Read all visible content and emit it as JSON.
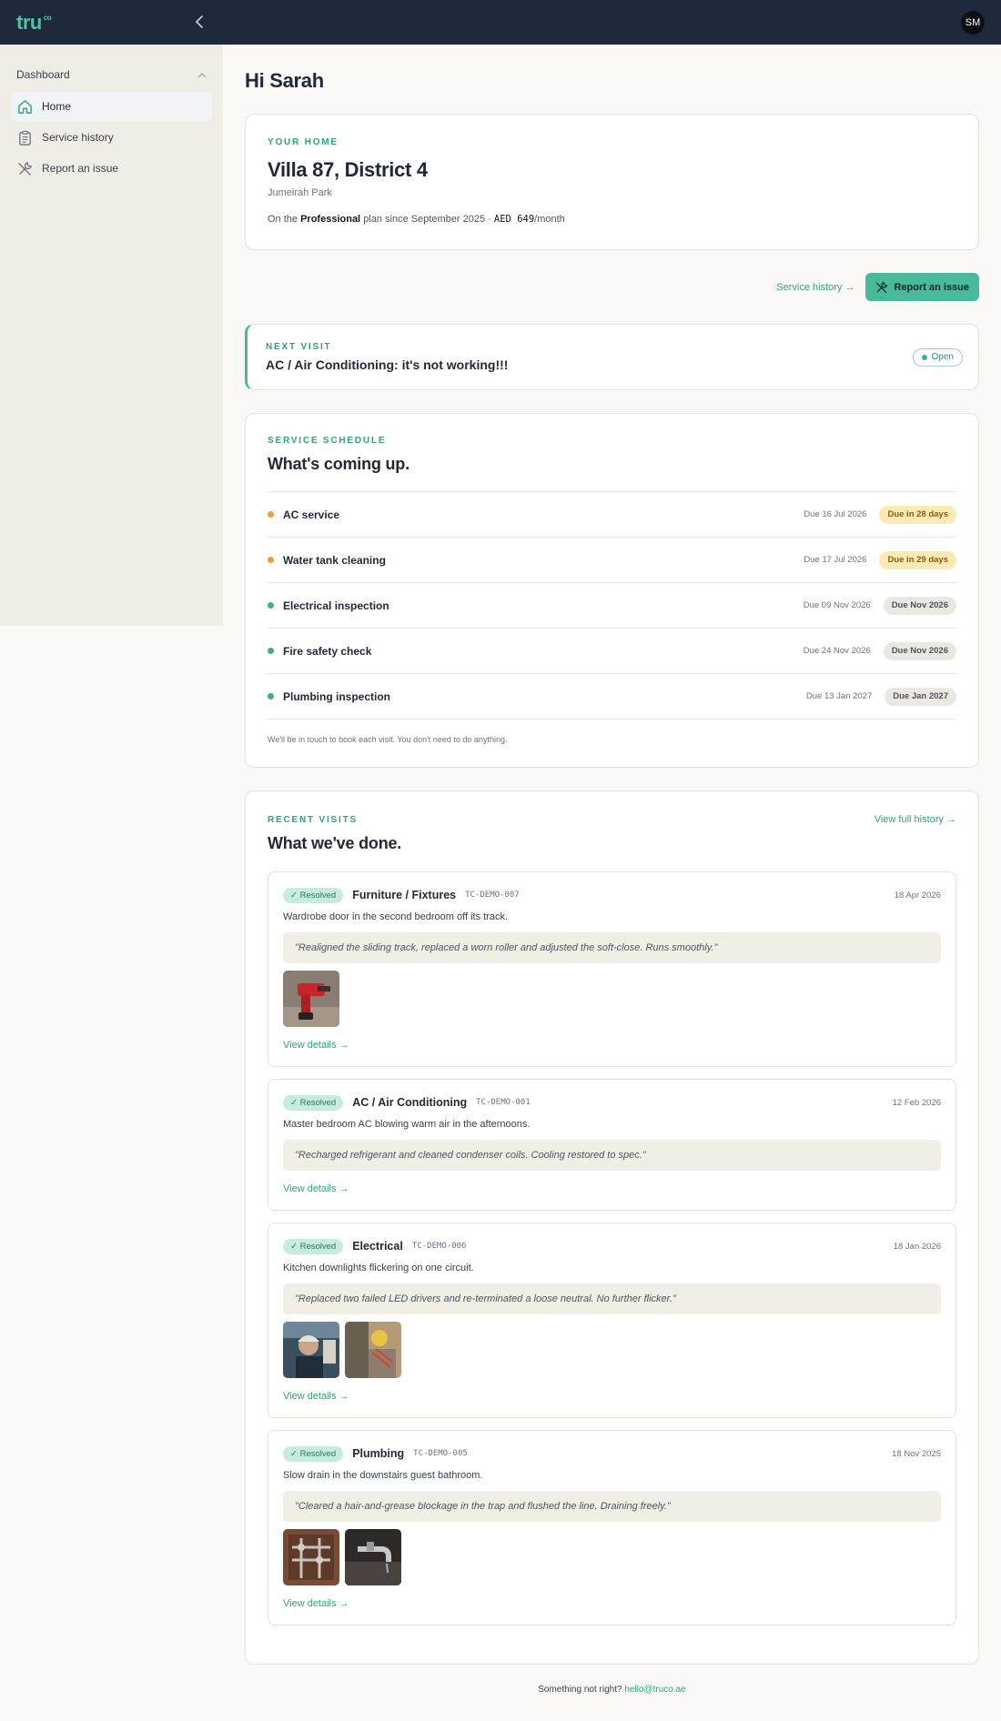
{
  "topbar": {
    "logo_text": "tru",
    "logo_sup": "co",
    "avatar_initials": "SM"
  },
  "sidebar": {
    "group_label": "Dashboard",
    "items": [
      {
        "label": "Home",
        "icon": "home-icon",
        "active": true
      },
      {
        "label": "Service history",
        "icon": "clipboard-icon",
        "active": false
      },
      {
        "label": "Report an issue",
        "icon": "tools-icon",
        "active": false
      }
    ]
  },
  "greeting": "Hi Sarah",
  "home": {
    "eyebrow": "YOUR HOME",
    "title": "Villa 87, District 4",
    "subtitle": "Jumeirah Park",
    "plan_prefix": "On the",
    "plan_name": "Professional",
    "plan_since": "plan since September 2025 ·",
    "plan_price": "AED 649",
    "plan_suffix": "/month"
  },
  "actions": {
    "history_link": "Service history →",
    "report_button": "Report an issue"
  },
  "next_visit": {
    "eyebrow": "NEXT VISIT",
    "title": "AC / Air Conditioning: it's not working!!!",
    "status": "Open"
  },
  "schedule": {
    "eyebrow": "SERVICE SCHEDULE",
    "title": "What's coming up.",
    "rows": [
      {
        "name": "AC service",
        "due": "Due 16 Jul 2026",
        "badge": "Due in 28 days",
        "kind": "warn",
        "dot": "#e8a23a"
      },
      {
        "name": "Water tank cleaning",
        "due": "Due 17 Jul 2026",
        "badge": "Due in 29 days",
        "kind": "warn",
        "dot": "#e8a23a"
      },
      {
        "name": "Electrical inspection",
        "due": "Due 09 Nov 2026",
        "badge": "Due Nov 2026",
        "kind": "neutral",
        "dot": "#3eaf8c"
      },
      {
        "name": "Fire safety check",
        "due": "Due 24 Nov 2026",
        "badge": "Due Nov 2026",
        "kind": "neutral",
        "dot": "#3eaf8c"
      },
      {
        "name": "Plumbing inspection",
        "due": "Due 13 Jan 2027",
        "badge": "Due Jan 2027",
        "kind": "neutral",
        "dot": "#3eaf8c"
      }
    ],
    "note": "We'll be in touch to book each visit. You don't need to do anything."
  },
  "recent": {
    "eyebrow": "RECENT VISITS",
    "title": "What we've done.",
    "full_history": "View full history →",
    "visits": [
      {
        "status": "✓ Resolved",
        "title": "Furniture / Fixtures",
        "code": "TC-DEMO-007",
        "date": "18 Apr 2026",
        "desc": "Wardrobe door in the second bedroom off its track.",
        "quote": "\"Realigned the sliding track, replaced a worn roller and adjusted the soft-close. Runs smoothly.\"",
        "photos": [
          "drill-photo"
        ],
        "view": "View details →"
      },
      {
        "status": "✓ Resolved",
        "title": "AC / Air Conditioning",
        "code": "TC-DEMO-001",
        "date": "12 Feb 2026",
        "desc": "Master bedroom AC blowing warm air in the afternoons.",
        "quote": "\"Recharged refrigerant and cleaned condenser coils. Cooling restored to spec.\"",
        "photos": [],
        "view": "View details →"
      },
      {
        "status": "✓ Resolved",
        "title": "Electrical",
        "code": "TC-DEMO-006",
        "date": "18 Jan 2026",
        "desc": "Kitchen downlights flickering on one circuit.",
        "quote": "\"Replaced two failed LED drivers and re-terminated a loose neutral. No further flicker.\"",
        "photos": [
          "electrician-photo",
          "wiring-photo"
        ],
        "view": "View details →"
      },
      {
        "status": "✓ Resolved",
        "title": "Plumbing",
        "code": "TC-DEMO-005",
        "date": "18 Nov 2025",
        "desc": "Slow drain in the downstairs guest bathroom.",
        "quote": "\"Cleared a hair-and-grease blockage in the trap and flushed the line. Draining freely.\"",
        "photos": [
          "pipes-photo",
          "faucet-photo"
        ],
        "view": "View details →"
      }
    ]
  },
  "footer": {
    "text": "Something not right?",
    "email": "hello@truco.ae"
  },
  "colors": {
    "topbar": "#1e2a3b",
    "accent": "#48b99a",
    "warn_badge": "#fde9b3",
    "sidebar": "#f0ede6"
  }
}
